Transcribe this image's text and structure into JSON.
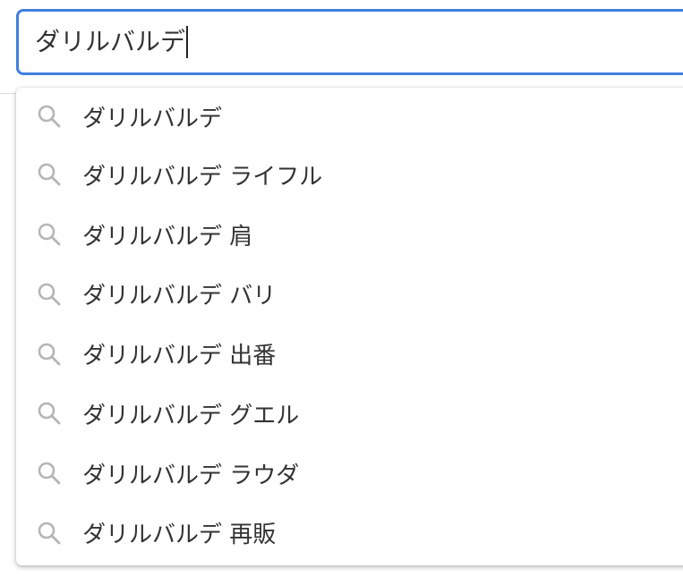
{
  "search": {
    "value": "ダリルバルデ"
  },
  "suggestions": [
    {
      "label": "ダリルバルデ"
    },
    {
      "label": "ダリルバルデ ライフル"
    },
    {
      "label": "ダリルバルデ 肩"
    },
    {
      "label": "ダリルバルデ バリ"
    },
    {
      "label": "ダリルバルデ 出番"
    },
    {
      "label": "ダリルバルデ グエル"
    },
    {
      "label": "ダリルバルデ ラウダ"
    },
    {
      "label": "ダリルバルデ 再販"
    }
  ],
  "icons": {
    "suggestion_icon": "search-icon"
  },
  "colors": {
    "focus_border": "#3f7fe0",
    "text": "#333333",
    "icon": "#b5b5b5"
  }
}
